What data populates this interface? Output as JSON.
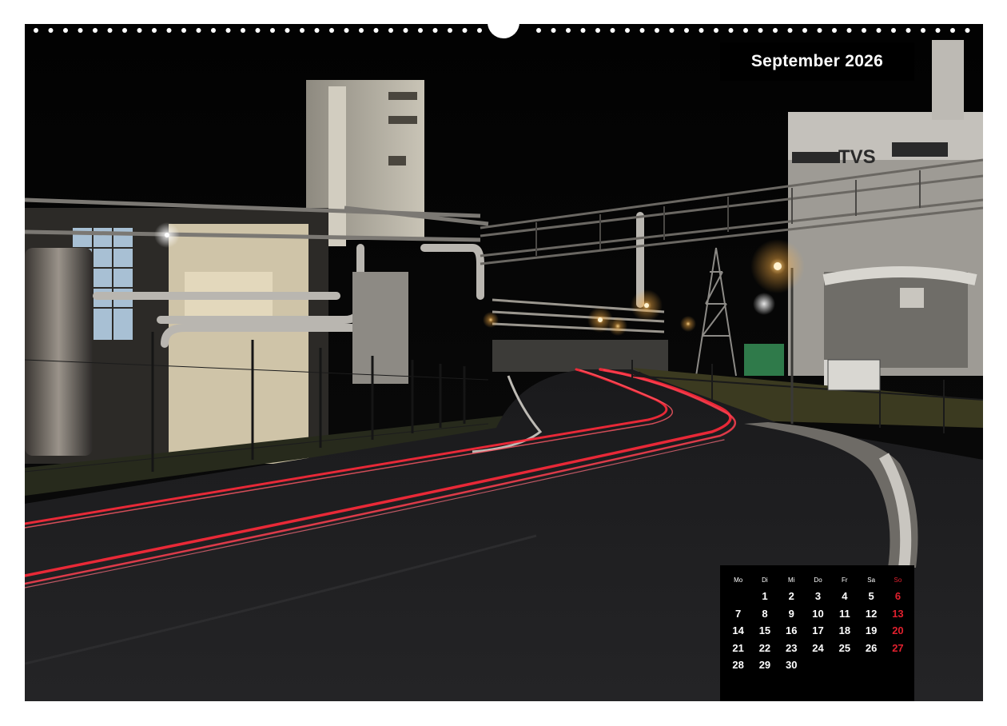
{
  "calendar": {
    "month_title": "September 2026",
    "weekdays": [
      "Mo",
      "Di",
      "Mi",
      "Do",
      "Fr",
      "Sa",
      "So"
    ],
    "first_weekday_index": 1,
    "days_in_month": 30,
    "sunday_color": "#e0202e",
    "text_color": "#ffffff",
    "box_color": "#000000"
  },
  "photo": {
    "building_sign": "TVS"
  },
  "colors": {
    "trail_red": "#ff2a3a",
    "sodium_light": "#ffb347",
    "page_background": "#ffffff"
  }
}
